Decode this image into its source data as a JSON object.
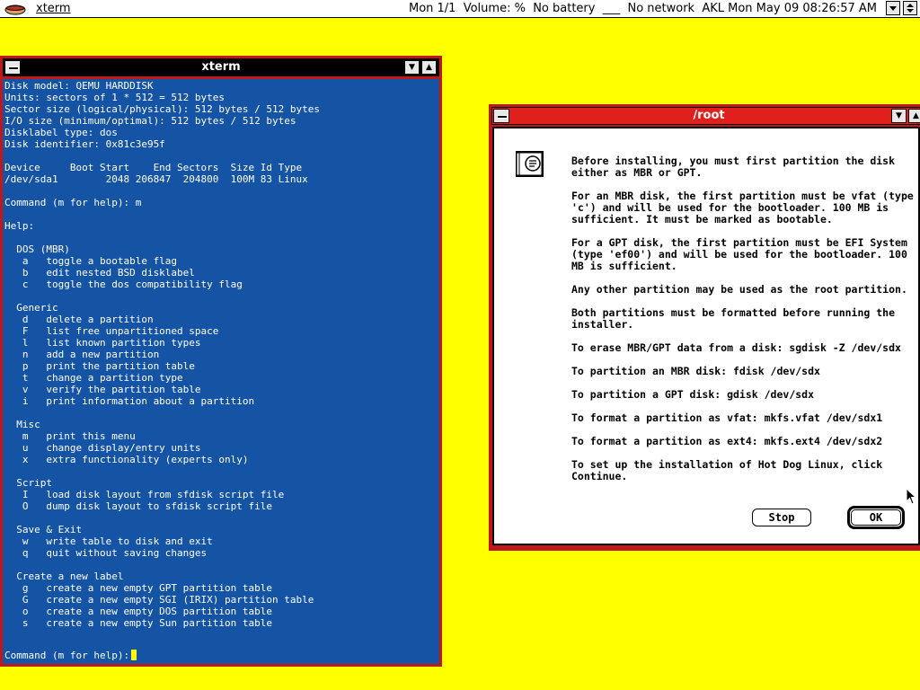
{
  "menubar": {
    "app_name": "xterm",
    "status": "Mon 1/1  Volume: %  No battery  ___  No network  AKL Mon May 09 08:26:57 AM"
  },
  "xterm": {
    "title": "xterm",
    "lines": [
      "Disk model: QEMU HARDDISK",
      "Units: sectors of 1 * 512 = 512 bytes",
      "Sector size (logical/physical): 512 bytes / 512 bytes",
      "I/O size (minimum/optimal): 512 bytes / 512 bytes",
      "Disklabel type: dos",
      "Disk identifier: 0x81c3e95f",
      "",
      "Device     Boot Start    End Sectors  Size Id Type",
      "/dev/sda1        2048 206847  204800  100M 83 Linux",
      "",
      "Command (m for help): m",
      "",
      "Help:",
      "",
      "  DOS (MBR)",
      "   a   toggle a bootable flag",
      "   b   edit nested BSD disklabel",
      "   c   toggle the dos compatibility flag",
      "",
      "  Generic",
      "   d   delete a partition",
      "   F   list free unpartitioned space",
      "   l   list known partition types",
      "   n   add a new partition",
      "   p   print the partition table",
      "   t   change a partition type",
      "   v   verify the partition table",
      "   i   print information about a partition",
      "",
      "  Misc",
      "   m   print this menu",
      "   u   change display/entry units",
      "   x   extra functionality (experts only)",
      "",
      "  Script",
      "   I   load disk layout from sfdisk script file",
      "   O   dump disk layout to sfdisk script file",
      "",
      "  Save & Exit",
      "   w   write table to disk and exit",
      "   q   quit without saving changes",
      "",
      "  Create a new label",
      "   g   create a new empty GPT partition table",
      "   G   create a new empty SGI (IRIX) partition table",
      "   o   create a new empty DOS partition table",
      "   s   create a new empty Sun partition table"
    ],
    "prompt": "Command (m for help):"
  },
  "dialog": {
    "title": "/root",
    "paragraphs": [
      "Before installing, you must first partition the disk either as MBR or GPT.",
      "For an MBR disk, the first partition must be vfat (type 'c') and will be used for the bootloader. 100 MB is sufficient. It must be marked as bootable.",
      "For a GPT disk, the first partition must be EFI System (type 'ef00') and will be used for the bootloader. 100 MB is sufficient.",
      "Any other partition may be used as the root partition.",
      "Both partitions must be formatted before running the installer.",
      "To erase MBR/GPT data from a disk: sgdisk -Z /dev/sdx",
      "To partition an MBR disk: fdisk /dev/sdx",
      "To partition a GPT disk: gdisk /dev/sdx",
      "To format a partition as vfat: mkfs.vfat /dev/sdx1",
      "To format a partition as ext4: mkfs.ext4 /dev/sdx2",
      "To set up the installation of Hot Dog Linux, click Continue."
    ],
    "stop_label": "Stop",
    "ok_label": "OK"
  },
  "colors": {
    "desktop": "#ffff00",
    "terminal_bg": "#1553a4",
    "window_frame": "#c01818",
    "active_title": "#e0201c"
  },
  "icons": [
    "hotdog-app-icon",
    "scroll-down-icon",
    "scroll-up-down-icon",
    "system-menu-icon",
    "minimize-icon",
    "maximize-icon",
    "info-document-icon",
    "mouse-pointer-icon"
  ]
}
